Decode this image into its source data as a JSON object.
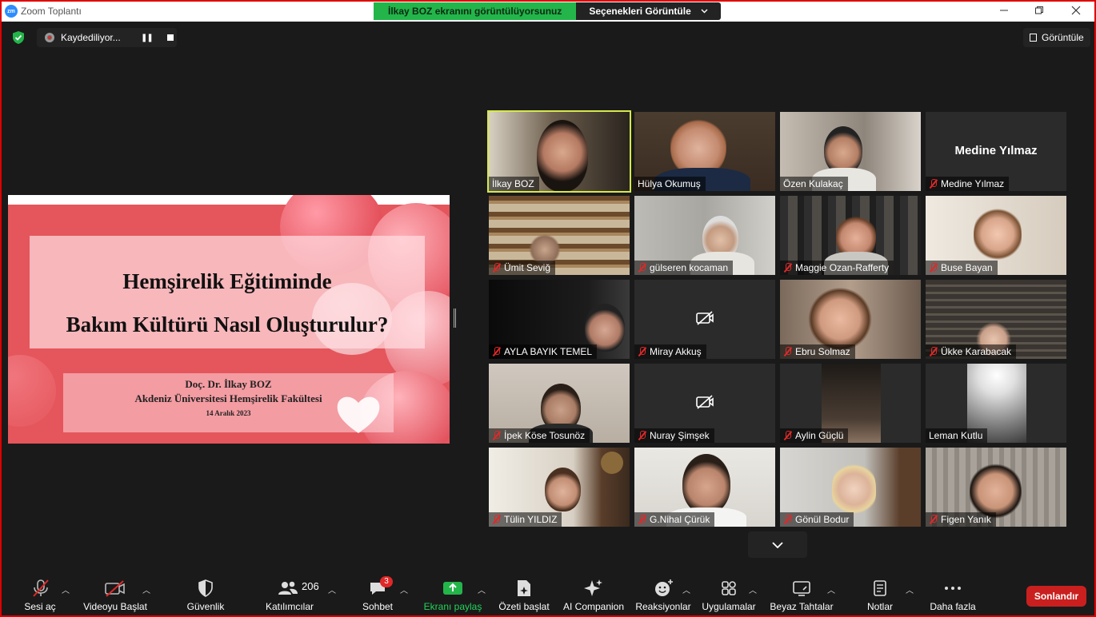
{
  "window": {
    "title": "Zoom Toplantı",
    "logo_text": "zm",
    "controls": [
      "minimize",
      "restore",
      "close"
    ]
  },
  "share_banner": {
    "status": "İlkay BOZ ekranını görüntülüyorsunuz",
    "view_options": "Seçenekleri Görüntüle"
  },
  "recording": {
    "label": "Kaydediliyor...",
    "pause_symbol": "❚❚"
  },
  "view_button": {
    "label": "Görüntüle"
  },
  "slide": {
    "title_line1": "Hemşirelik Eğitiminde",
    "title_line2": "Bakım Kültürü Nasıl Oluşturulur?",
    "author": "Doç. Dr. İlkay BOZ",
    "institution": "Akdeniz Üniversitesi Hemşirelik Fakültesi",
    "date": "14 Aralık 2023"
  },
  "participants": [
    {
      "name": "İlkay BOZ",
      "muted": false,
      "video": true,
      "active_speaker": true
    },
    {
      "name": "Hülya Okumuş",
      "muted": false,
      "video": true
    },
    {
      "name": "Özen Kulakaç",
      "muted": false,
      "video": true
    },
    {
      "name": "Medine Yılmaz",
      "muted": true,
      "video": false,
      "display_name": "Medine Yılmaz"
    },
    {
      "name": "Ümit Seviğ",
      "muted": true,
      "video": true
    },
    {
      "name": "gülseren kocaman",
      "muted": true,
      "video": true
    },
    {
      "name": "Maggie Ozan-Rafferty",
      "muted": true,
      "video": true
    },
    {
      "name": "Buse Bayan",
      "muted": true,
      "video": true
    },
    {
      "name": "AYLA BAYIK TEMEL",
      "muted": true,
      "video": true
    },
    {
      "name": "Miray Akkuş",
      "muted": true,
      "video": false
    },
    {
      "name": "Ebru Solmaz",
      "muted": true,
      "video": true
    },
    {
      "name": "Ükke Karabacak",
      "muted": true,
      "video": true
    },
    {
      "name": "İpek Köse Tosunöz",
      "muted": true,
      "video": true
    },
    {
      "name": "Nuray Şimşek",
      "muted": true,
      "video": false
    },
    {
      "name": "Aylin Güçlü",
      "muted": true,
      "video": true
    },
    {
      "name": "Leman Kutlu",
      "muted": false,
      "video": true
    },
    {
      "name": "Tülin YILDIZ",
      "muted": true,
      "video": true
    },
    {
      "name": "G.Nihal Çürük",
      "muted": true,
      "video": true
    },
    {
      "name": "Gönül Bodur",
      "muted": true,
      "video": true
    },
    {
      "name": "Figen Yanık",
      "muted": true,
      "video": true
    }
  ],
  "toolbar": {
    "unmute": "Sesi aç",
    "start_video": "Videoyu Başlat",
    "security": "Güvenlik",
    "participants": "Katılımcılar",
    "participants_count": "206",
    "chat": "Sohbet",
    "chat_badge": "3",
    "share_screen": "Ekranı paylaş",
    "summary": "Özeti başlat",
    "ai_companion": "AI Companion",
    "reactions": "Reaksiyonlar",
    "apps": "Uygulamalar",
    "whiteboards": "Beyaz Tahtalar",
    "notes": "Notlar",
    "more": "Daha fazla",
    "end": "Sonlandır"
  },
  "colors": {
    "accent_green": "#23b54a",
    "active_speaker": "#d6e94a",
    "end_red": "#c9201f",
    "slide_red": "#e4565b"
  }
}
